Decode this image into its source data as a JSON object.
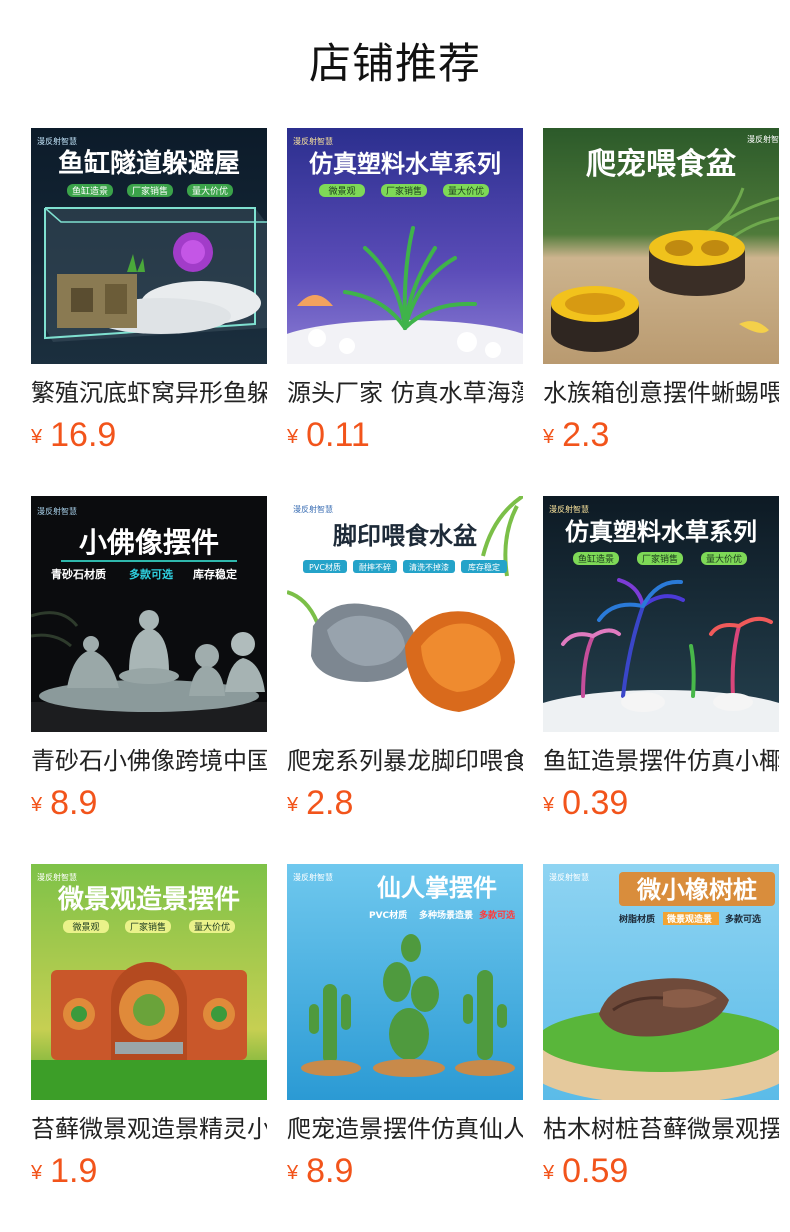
{
  "page": {
    "title": "店铺推荐",
    "currency": "¥",
    "price_color": "#f2541b"
  },
  "products": [
    {
      "name": "繁殖沉底虾窝异形鱼躲避屋",
      "price": "16.9",
      "banner": "鱼缸隧道躲避屋",
      "tags": [
        "鱼缸造景",
        "厂家销售",
        "量大价优"
      ],
      "brand": "漫反射智慧"
    },
    {
      "name": "源头厂家 仿真水草海藻套装",
      "price": "0.11",
      "banner": "仿真塑料水草系列",
      "tags": [
        "微景观",
        "厂家销售",
        "量大价优"
      ],
      "brand": "漫反射智慧"
    },
    {
      "name": "水族箱创意摆件蜥蜴喂食盆",
      "price": "2.3",
      "banner": "爬宠喂食盆",
      "tags": [],
      "brand": "漫反射智慧"
    },
    {
      "name": "青砂石小佛像跨境中国风摆件",
      "price": "8.9",
      "banner": "小佛像摆件",
      "tags": [
        "青砂石材质",
        "多款可选",
        "库存稳定"
      ],
      "brand": "漫反射智慧"
    },
    {
      "name": "爬宠系列暴龙脚印喂食水盆",
      "price": "2.8",
      "banner": "脚印喂食水盆",
      "tags": [
        "PVC材质",
        "耐摔不碎",
        "清洗不掉漆",
        "库存稳定"
      ],
      "brand": "漫反射智慧"
    },
    {
      "name": "鱼缸造景摆件仿真小椰子树",
      "price": "0.39",
      "banner": "仿真塑料水草系列",
      "tags": [
        "鱼缸造景",
        "厂家销售",
        "量大价优"
      ],
      "brand": "漫反射智慧"
    },
    {
      "name": "苔藓微景观造景精灵小屋",
      "price": "1.9",
      "banner": "微景观造景摆件",
      "tags": [
        "微景观",
        "厂家销售",
        "量大价优"
      ],
      "brand": "漫反射智慧"
    },
    {
      "name": "爬宠造景摆件仿真仙人掌",
      "price": "8.9",
      "banner": "仙人掌摆件",
      "tags": [
        "PVC材质",
        "多种场景造景",
        "多款可选"
      ],
      "brand": "漫反射智慧"
    },
    {
      "name": "枯木树桩苔藓微景观摆件",
      "price": "0.59",
      "banner": "微小橡树桩",
      "tags": [
        "树脂材质",
        "微景观造景",
        "多款可选"
      ],
      "brand": "漫反射智慧"
    }
  ]
}
